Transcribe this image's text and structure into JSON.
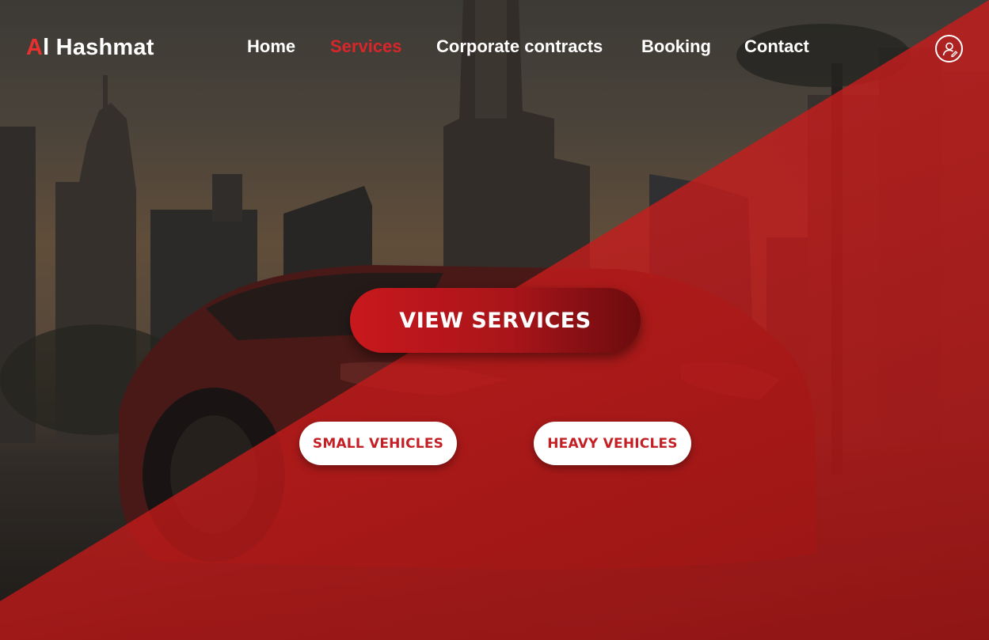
{
  "brand": {
    "logo_accent": "A",
    "logo_rest": "l Hashmat",
    "accent_color": "#e8302f"
  },
  "nav": {
    "items": [
      {
        "label": "Home",
        "active": false
      },
      {
        "label": "Services",
        "active": true
      },
      {
        "label": "Corporate contracts",
        "active": false
      },
      {
        "label": "Booking",
        "active": false
      },
      {
        "label": "Contact",
        "active": false
      }
    ],
    "active_color": "#d8262a"
  },
  "account": {
    "icon": "user-profile-icon"
  },
  "hero": {
    "cta_label": "VIEW SERVICES",
    "options": [
      {
        "label": "SMALL VEHICLES"
      },
      {
        "label": "HEAVY VEHICLES"
      }
    ],
    "overlay_color": "#d62222"
  }
}
